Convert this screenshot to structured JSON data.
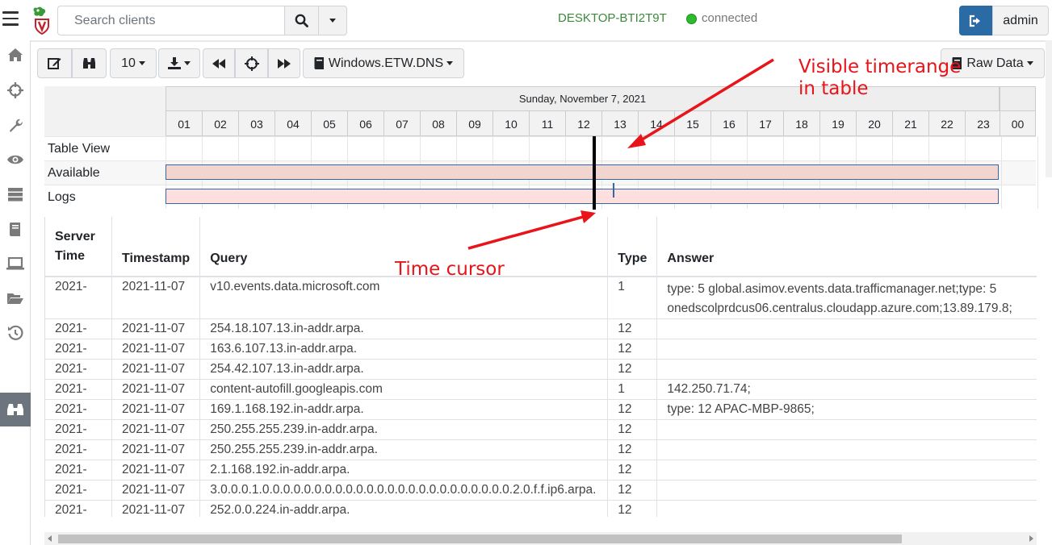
{
  "header": {
    "search_placeholder": "Search clients",
    "hostname": "DESKTOP-BTI2T9T",
    "status": "connected",
    "user": "admin"
  },
  "sidebar": {
    "icons": [
      "home-icon",
      "crosshair-icon",
      "wrench-icon",
      "eye-icon",
      "server-icon",
      "book-icon",
      "laptop-icon",
      "folder-open-icon",
      "history-icon",
      "binoculars-icon"
    ],
    "active": "binoculars-icon"
  },
  "toolbar": {
    "page_size": "10",
    "artifact": "Windows.ETW.DNS",
    "view_mode": "Raw Data"
  },
  "timeline": {
    "date": "Sunday, November 7, 2021",
    "hours": [
      "01",
      "02",
      "03",
      "04",
      "05",
      "06",
      "07",
      "08",
      "09",
      "10",
      "11",
      "12",
      "13",
      "14",
      "15",
      "16",
      "17",
      "18",
      "19",
      "20",
      "21",
      "22",
      "23",
      "00"
    ],
    "rows": [
      "Table View",
      "Available",
      "Logs"
    ],
    "cursor_hour": 12.85,
    "visible_range_hour": 13.35
  },
  "table": {
    "columns": [
      "Server Time",
      "Timestamp",
      "Query",
      "Type",
      "Answer"
    ],
    "rows": [
      {
        "server_time": "2021-",
        "timestamp": "2021-11-07",
        "query": "v10.events.data.microsoft.com",
        "type": "1",
        "answer": "type: 5 global.asimov.events.data.trafficmanager.net;type: 5 onedscolprdcus06.centralus.cloudapp.azure.com;13.89.179.8;"
      },
      {
        "server_time": "2021-",
        "timestamp": "2021-11-07",
        "query": "254.18.107.13.in-addr.arpa.",
        "type": "12",
        "answer": ""
      },
      {
        "server_time": "2021-",
        "timestamp": "2021-11-07",
        "query": "163.6.107.13.in-addr.arpa.",
        "type": "12",
        "answer": ""
      },
      {
        "server_time": "2021-",
        "timestamp": "2021-11-07",
        "query": "254.42.107.13.in-addr.arpa.",
        "type": "12",
        "answer": ""
      },
      {
        "server_time": "2021-",
        "timestamp": "2021-11-07",
        "query": "content-autofill.googleapis.com",
        "type": "1",
        "answer": "142.250.71.74;"
      },
      {
        "server_time": "2021-",
        "timestamp": "2021-11-07",
        "query": "169.1.168.192.in-addr.arpa.",
        "type": "12",
        "answer": "type: 12 APAC-MBP-9865;"
      },
      {
        "server_time": "2021-",
        "timestamp": "2021-11-07",
        "query": "250.255.255.239.in-addr.arpa.",
        "type": "12",
        "answer": ""
      },
      {
        "server_time": "2021-",
        "timestamp": "2021-11-07",
        "query": "250.255.255.239.in-addr.arpa.",
        "type": "12",
        "answer": ""
      },
      {
        "server_time": "2021-",
        "timestamp": "2021-11-07",
        "query": "2.1.168.192.in-addr.arpa.",
        "type": "12",
        "answer": ""
      },
      {
        "server_time": "2021-",
        "timestamp": "2021-11-07",
        "query": "3.0.0.0.1.0.0.0.0.0.0.0.0.0.0.0.0.0.0.0.0.0.0.0.0.0.0.0.0.2.0.f.f.ip6.arpa.",
        "type": "12",
        "answer": ""
      },
      {
        "server_time": "2021-",
        "timestamp": "2021-11-07",
        "query": "252.0.0.224.in-addr.arpa.",
        "type": "12",
        "answer": ""
      }
    ]
  },
  "annotations": {
    "visible_range": "Visible timerange in table",
    "time_cursor": "Time cursor"
  },
  "colors": {
    "available_bar": "#f2d5cf",
    "logs_bar": "#fde0dd",
    "logout_button": "#2a6aa5",
    "annotation": "#e8141a"
  }
}
